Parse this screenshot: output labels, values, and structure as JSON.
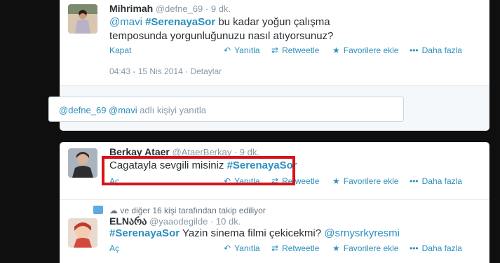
{
  "tweet1": {
    "name": "Mihrimah",
    "handle": "@defne_69",
    "time": "· 9 dk.",
    "text_mention": "@mavi",
    "text_hashtag": "#SerenayaSor",
    "text_rest": " bu kadar yoğun çalışma temposunda yorgunluğunuzu nasıl atıyorsunuz?",
    "close_label": "Kapat",
    "reply_label": "Yanıtla",
    "retweet_label": "Retweetle",
    "favorite_label": "Favorilere ekle",
    "more_label": "Daha fazla",
    "timestamp": "04:43 - 15 Nis 2014",
    "details_label": "· Detaylar",
    "reply_box_mentions": "@defne_69 @mavi",
    "reply_box_placeholder": " adlı kişiyi yanıtla"
  },
  "tweet2": {
    "name": "Berkay Ataer",
    "handle": "@AtaerBerkay",
    "time": "· 9 dk.",
    "text_plain": "Cagatayla sevgili misiniz ",
    "text_hashtag": "#SerenayaSor",
    "open_label": "Aç",
    "reply_label": "Yanıtla",
    "retweet_label": "Retweetle",
    "favorite_label": "Favorilere ekle",
    "more_label": "Daha fazla"
  },
  "tweet3": {
    "followed_by": "ve diğer 16 kişi tarafından takip ediliyor",
    "name": "ELNარა",
    "handle": "@yaaodegilde",
    "time": "· 10 dk.",
    "text_hashtag": "#SerenayaSor",
    "text_plain": " Yazin sinema filmi çekicekmi? ",
    "text_mention": "@srnysrkyresmi",
    "open_label": "Aç",
    "reply_label": "Yanıtla",
    "retweet_label": "Retweetle",
    "favorite_label": "Favorilere ekle",
    "more_label": "Daha fazla"
  },
  "colors": {
    "link": "#2a8fbd",
    "highlight": "#d9121a"
  }
}
